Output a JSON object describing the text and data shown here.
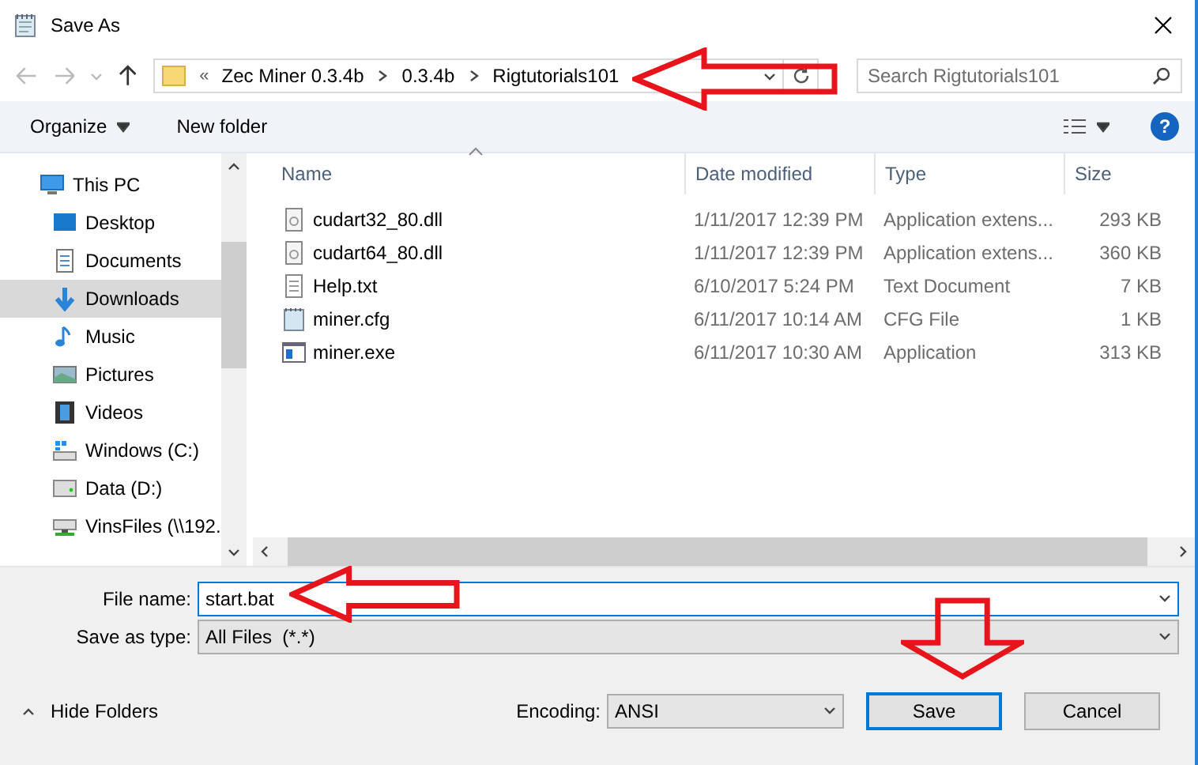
{
  "window": {
    "title": "Save As"
  },
  "address_bar": {
    "overflow": "«",
    "path": [
      "Zec Miner 0.3.4b",
      "0.3.4b",
      "Rigtutorials101"
    ]
  },
  "search": {
    "placeholder": "Search Rigtutorials101"
  },
  "toolbar": {
    "organize": "Organize",
    "new_folder": "New folder",
    "help": "?"
  },
  "sidebar": {
    "items": [
      {
        "label": "This PC",
        "selected": false,
        "children": [
          {
            "label": "Desktop",
            "selected": false
          },
          {
            "label": "Documents",
            "selected": false
          },
          {
            "label": "Downloads",
            "selected": true
          },
          {
            "label": "Music",
            "selected": false
          },
          {
            "label": "Pictures",
            "selected": false
          },
          {
            "label": "Videos",
            "selected": false
          },
          {
            "label": "Windows (C:)",
            "selected": false
          },
          {
            "label": "Data (D:)",
            "selected": false
          },
          {
            "label": "VinsFiles (\\\\192.",
            "selected": false
          }
        ]
      }
    ]
  },
  "table": {
    "columns": [
      "Name",
      "Date modified",
      "Type",
      "Size"
    ],
    "rows": [
      {
        "name": "cudart32_80.dll",
        "date": "1/11/2017 12:39 PM",
        "type": "Application extens...",
        "size": "293 KB"
      },
      {
        "name": "cudart64_80.dll",
        "date": "1/11/2017 12:39 PM",
        "type": "Application extens...",
        "size": "360 KB"
      },
      {
        "name": "Help.txt",
        "date": "6/10/2017 5:24 PM",
        "type": "Text Document",
        "size": "7 KB"
      },
      {
        "name": "miner.cfg",
        "date": "6/11/2017 10:14 AM",
        "type": "CFG File",
        "size": "1 KB"
      },
      {
        "name": "miner.exe",
        "date": "6/11/2017 10:30 AM",
        "type": "Application",
        "size": "313 KB"
      }
    ]
  },
  "form": {
    "file_name_label": "File name:",
    "file_name": "start.bat",
    "type_label": "Save as type:",
    "type_value": "All Files  (*.*)"
  },
  "footer": {
    "hide_folders": "Hide Folders",
    "encoding_label": "Encoding:",
    "encoding": "ANSI",
    "save": "Save",
    "cancel": "Cancel"
  },
  "annotations": [
    {
      "kind": "left"
    },
    {
      "kind": "left"
    },
    {
      "kind": "down"
    }
  ]
}
